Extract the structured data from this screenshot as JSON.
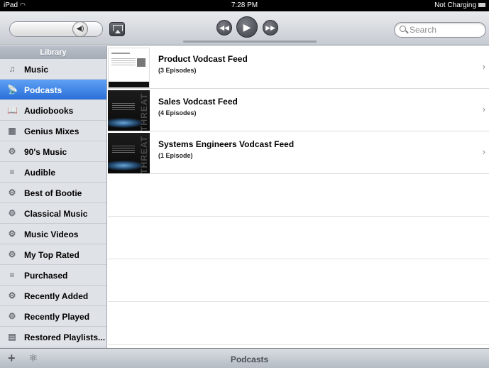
{
  "status": {
    "device": "iPad",
    "time": "7:28 PM",
    "battery": "Not Charging"
  },
  "search": {
    "placeholder": "Search"
  },
  "icons": {
    "volume": "speaker-icon",
    "airplay": "airplay-icon",
    "prev": "rewind-icon",
    "play": "play-icon",
    "next": "fast-forward-icon",
    "search": "search-icon",
    "add": "plus-icon",
    "genius": "genius-atom-icon",
    "chevron": "chevron-right-icon"
  },
  "sidebar": {
    "header": "Library",
    "items": [
      {
        "label": "Music",
        "icon": "♫",
        "active": false
      },
      {
        "label": "Podcasts",
        "icon": "📡",
        "active": true
      },
      {
        "label": "Audiobooks",
        "icon": "📖",
        "active": false
      },
      {
        "label": "Genius Mixes",
        "icon": "▦",
        "active": false
      },
      {
        "label": "90's Music",
        "icon": "⚙",
        "active": false
      },
      {
        "label": "Audible",
        "icon": "≡",
        "active": false
      },
      {
        "label": "Best of Bootie",
        "icon": "⚙",
        "active": false
      },
      {
        "label": "Classical Music",
        "icon": "⚙",
        "active": false
      },
      {
        "label": "Music Videos",
        "icon": "⚙",
        "active": false
      },
      {
        "label": "My Top Rated",
        "icon": "⚙",
        "active": false
      },
      {
        "label": "Purchased",
        "icon": "≡",
        "active": false
      },
      {
        "label": "Recently Added",
        "icon": "⚙",
        "active": false
      },
      {
        "label": "Recently Played",
        "icon": "⚙",
        "active": false
      },
      {
        "label": "Restored Playlists...",
        "icon": "▤",
        "active": false
      }
    ]
  },
  "feeds": [
    {
      "title": "Product Vodcast Feed",
      "episodes": "(3 Episodes)",
      "thumb": "light"
    },
    {
      "title": "Sales Vodcast Feed",
      "episodes": "(4 Episodes)",
      "thumb": "dark",
      "thumb_text": "THREAT"
    },
    {
      "title": "Systems Engineers Vodcast Feed",
      "episodes": "(1 Episode)",
      "thumb": "dark",
      "thumb_text": "THREAT"
    }
  ],
  "chevron": "›",
  "bottom": {
    "title": "Podcasts",
    "add": "+",
    "genius": "⚛"
  },
  "colors": {
    "selection": "#2a6fd8",
    "sidebar_bg": "#dfe2e7",
    "toolbar": "#c6cad1"
  }
}
